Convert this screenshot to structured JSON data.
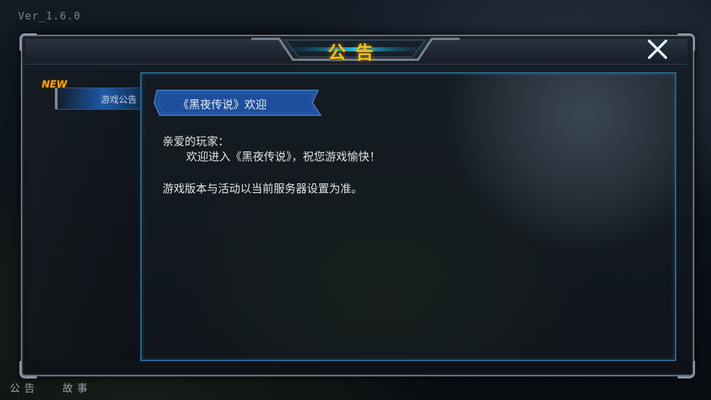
{
  "version": "Ver_1.6.0",
  "dialog": {
    "title": "公告",
    "close_icon": "close-icon"
  },
  "sidebar": {
    "new_badge": "NEW",
    "items": [
      {
        "label": "游戏公告",
        "selected": true
      }
    ]
  },
  "announcement": {
    "heading": "《黑夜传说》欢迎",
    "greeting": "亲爱的玩家：",
    "line1": "欢迎进入《黑夜传说》，祝您游戏愉快！",
    "line2": "游戏版本与活动以当前服务器设置为准。"
  },
  "bottom_tabs": [
    "公告",
    "故事"
  ],
  "colors": {
    "title": "#f0c020",
    "accent_blue": "#1c5aa6",
    "new_badge": "#f2a516",
    "text": "#e4e4e4"
  }
}
